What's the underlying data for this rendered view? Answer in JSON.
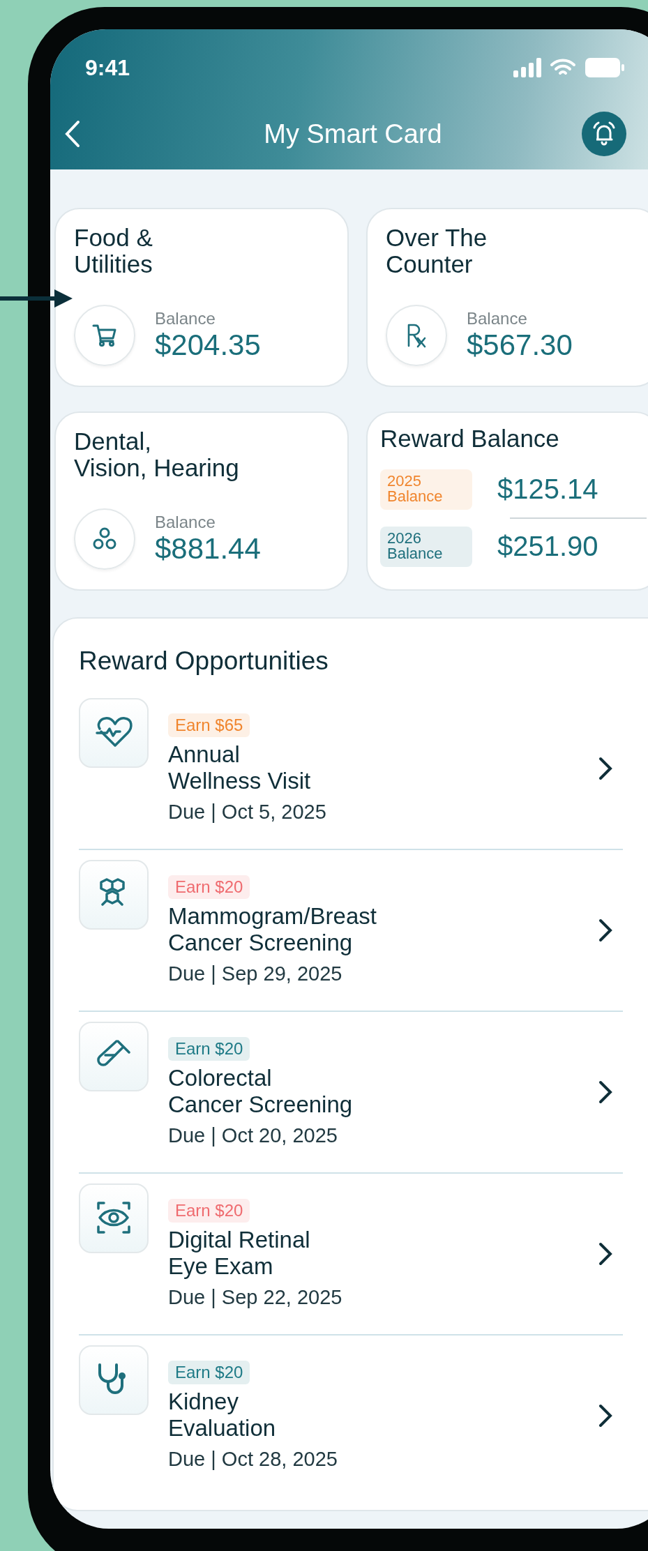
{
  "status_bar": {
    "time": "9:41"
  },
  "header": {
    "title": "My Smart Card"
  },
  "balance_cards": [
    {
      "kind": "cart",
      "title": "Food &\nUtilities",
      "label": "Balance",
      "amount": "$204.35"
    },
    {
      "kind": "rx",
      "title": "Over The\nCounter",
      "label": "Balance",
      "amount": "$567.30"
    },
    {
      "kind": "circles",
      "title": "Dental,\nVision, Hearing",
      "label": "Balance",
      "amount": "$881.44"
    }
  ],
  "reward_balance": {
    "title": "Reward Balance",
    "years": [
      {
        "label": "2025\nBalance",
        "color": "#f0852d",
        "amount": "$125.14"
      },
      {
        "label": "2026\nBalance",
        "color": "#1e6f7c",
        "amount": "$251.90"
      }
    ]
  },
  "opportunities": {
    "title": "Reward Opportunities",
    "items": [
      {
        "kind": "heart",
        "badge": "Earn $65",
        "color": "#f0852d",
        "title": "Annual\nWellness Visit",
        "due": "Due | Oct 5, 2025"
      },
      {
        "kind": "hexagons",
        "badge": "Earn $20",
        "color": "#ef6b6f",
        "title": "Mammogram/Breast\nCancer Screening",
        "due": "Due | Sep 29, 2025"
      },
      {
        "kind": "tube",
        "badge": "Earn $20",
        "color": "#1e7a86",
        "title": "Colorectal\nCancer Screening",
        "due": "Due | Oct 20, 2025"
      },
      {
        "kind": "eye",
        "badge": "Earn $20",
        "color": "#ef6b6f",
        "title": "Digital Retinal\nEye Exam",
        "due": "Due | Sep 22, 2025"
      },
      {
        "kind": "stethoscope",
        "badge": "Earn $20",
        "color": "#1e7a86",
        "title": "Kidney\nEvaluation",
        "due": "Due | Oct 28, 2025"
      }
    ]
  }
}
